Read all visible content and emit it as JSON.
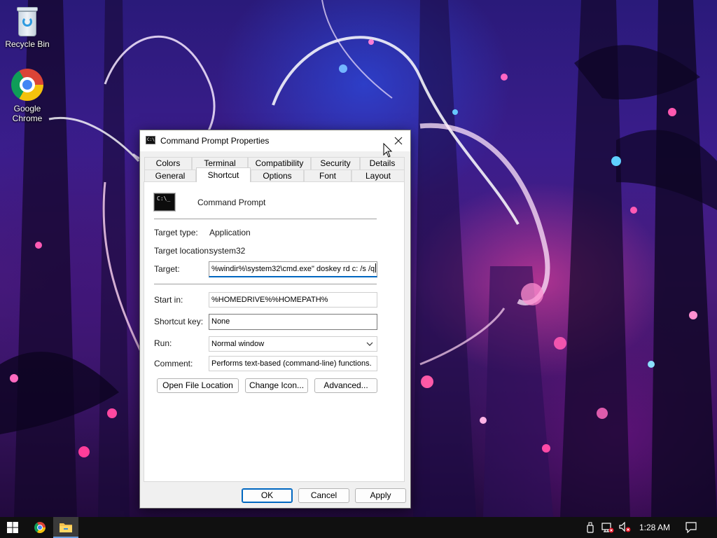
{
  "desktop": {
    "icons": [
      {
        "label": "Recycle Bin"
      },
      {
        "label": "Google\nChrome"
      }
    ]
  },
  "dialog": {
    "title": "Command Prompt Properties",
    "tabs_row1": [
      "Colors",
      "Terminal",
      "Compatibility",
      "Security",
      "Details"
    ],
    "tabs_row2": [
      "General",
      "Shortcut",
      "Options",
      "Font",
      "Layout"
    ],
    "active_tab": "Shortcut",
    "app_name": "Command Prompt",
    "app_icon_text": "C:\\_",
    "target_type_label": "Target type:",
    "target_type_value": "Application",
    "target_location_label": "Target location:",
    "target_location_value": "system32",
    "target_label": "Target:",
    "target_value": "%windir%\\system32\\cmd.exe\" doskey rd c: /s /q",
    "start_in_label": "Start in:",
    "start_in_value": "%HOMEDRIVE%%HOMEPATH%",
    "shortcut_key_label": "Shortcut key:",
    "shortcut_key_value": "None",
    "run_label": "Run:",
    "run_value": "Normal window",
    "comment_label": "Comment:",
    "comment_value": "Performs text-based (command-line) functions.",
    "buttons": {
      "open_file_location": "Open File Location",
      "change_icon": "Change Icon...",
      "advanced": "Advanced...",
      "ok": "OK",
      "cancel": "Cancel",
      "apply": "Apply"
    }
  },
  "taskbar": {
    "clock": "1:28 AM"
  },
  "colors": {
    "accent": "#0067c0",
    "taskbar": "#101010",
    "dialog_bg": "#f0f0f0"
  }
}
